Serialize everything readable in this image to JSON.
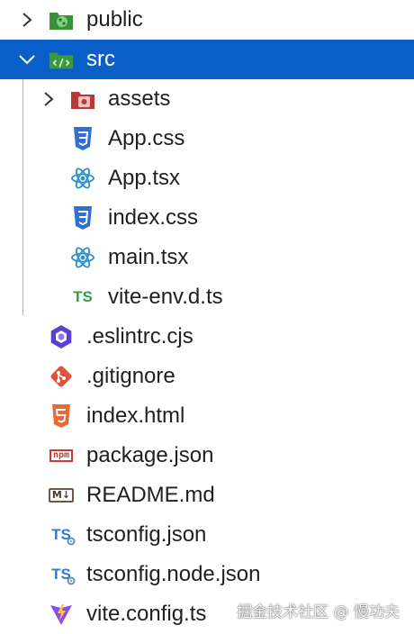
{
  "explorer": {
    "items": [
      {
        "label": "public",
        "icon": "public-folder-icon",
        "chevron": "chevron-right"
      },
      {
        "label": "src",
        "icon": "src-folder-icon",
        "chevron": "chevron-down",
        "selected": true
      },
      {
        "label": "assets",
        "icon": "assets-folder-icon",
        "chevron": "chevron-right"
      },
      {
        "label": "App.css",
        "icon": "css-icon"
      },
      {
        "label": "App.tsx",
        "icon": "react-icon"
      },
      {
        "label": "index.css",
        "icon": "css-icon"
      },
      {
        "label": "main.tsx",
        "icon": "react-icon"
      },
      {
        "label": "vite-env.d.ts",
        "icon": "ts-icon",
        "icon_text": "TS"
      },
      {
        "label": ".eslintrc.cjs",
        "icon": "eslint-icon"
      },
      {
        "label": ".gitignore",
        "icon": "git-icon"
      },
      {
        "label": "index.html",
        "icon": "html5-icon"
      },
      {
        "label": "package.json",
        "icon": "npm-icon",
        "icon_text": "npm"
      },
      {
        "label": "README.md",
        "icon": "markdown-icon",
        "icon_text": "M↓"
      },
      {
        "label": "tsconfig.json",
        "icon": "tsconfig-icon",
        "icon_text": "TS"
      },
      {
        "label": "tsconfig.node.json",
        "icon": "tsconfig-icon",
        "icon_text": "TS"
      },
      {
        "label": "vite.config.ts",
        "icon": "vite-icon"
      }
    ]
  },
  "watermark": "掘金技术社区 @ 慢功夫",
  "colors": {
    "selection": "#0b5fc8",
    "css": "#2f6fd6",
    "react": "#2b8fd0",
    "ts_green": "#2ea043",
    "ts_blue": "#2f7ad6",
    "eslint": "#5b3fd1",
    "git": "#e0533a",
    "html": "#e86a33",
    "npm": "#c73a3a",
    "vite": "#8a4ef0"
  }
}
